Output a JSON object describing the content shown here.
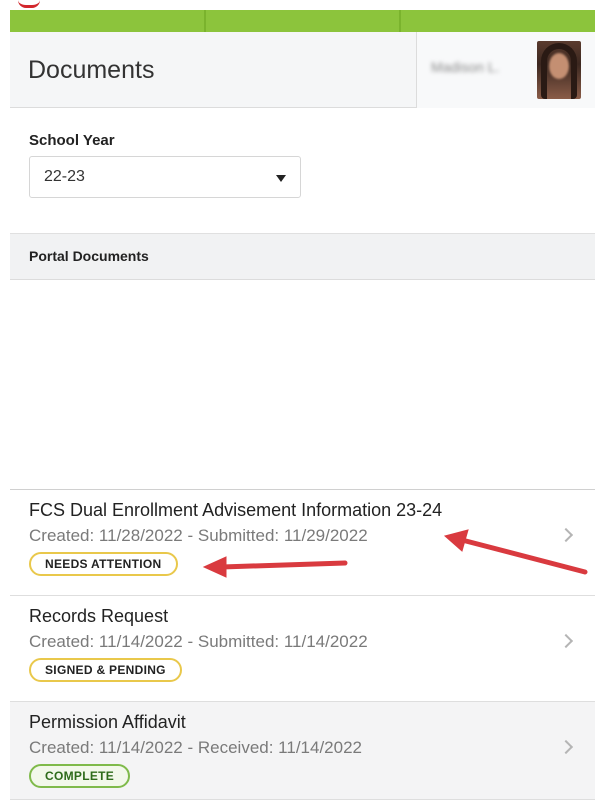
{
  "header": {
    "title": "Documents",
    "user_name": "Madison L."
  },
  "filter": {
    "label": "School Year",
    "selected": "22-23"
  },
  "section": {
    "title": "Portal Documents"
  },
  "documents": [
    {
      "name": "FCS Dual Enrollment Advisement Information 23-24",
      "meta": "Created: 11/28/2022 - Submitted: 11/29/2022",
      "status": "NEEDS ATTENTION"
    },
    {
      "name": "Records Request",
      "meta": "Created: 11/14/2022 - Submitted: 11/14/2022",
      "status": "SIGNED & PENDING"
    },
    {
      "name": "Permission Affidavit",
      "meta": "Created: 11/14/2022 - Received: 11/14/2022",
      "status": "COMPLETE"
    }
  ],
  "colors": {
    "accent_green": "#8cc43c",
    "attention_yellow": "#e9c84b",
    "complete_green": "#7fba4a",
    "annotation_red": "#d93a3f"
  },
  "icons": [
    "avatar",
    "dropdown-caret-icon",
    "chevron-right-icon",
    "annotation-arrow"
  ]
}
